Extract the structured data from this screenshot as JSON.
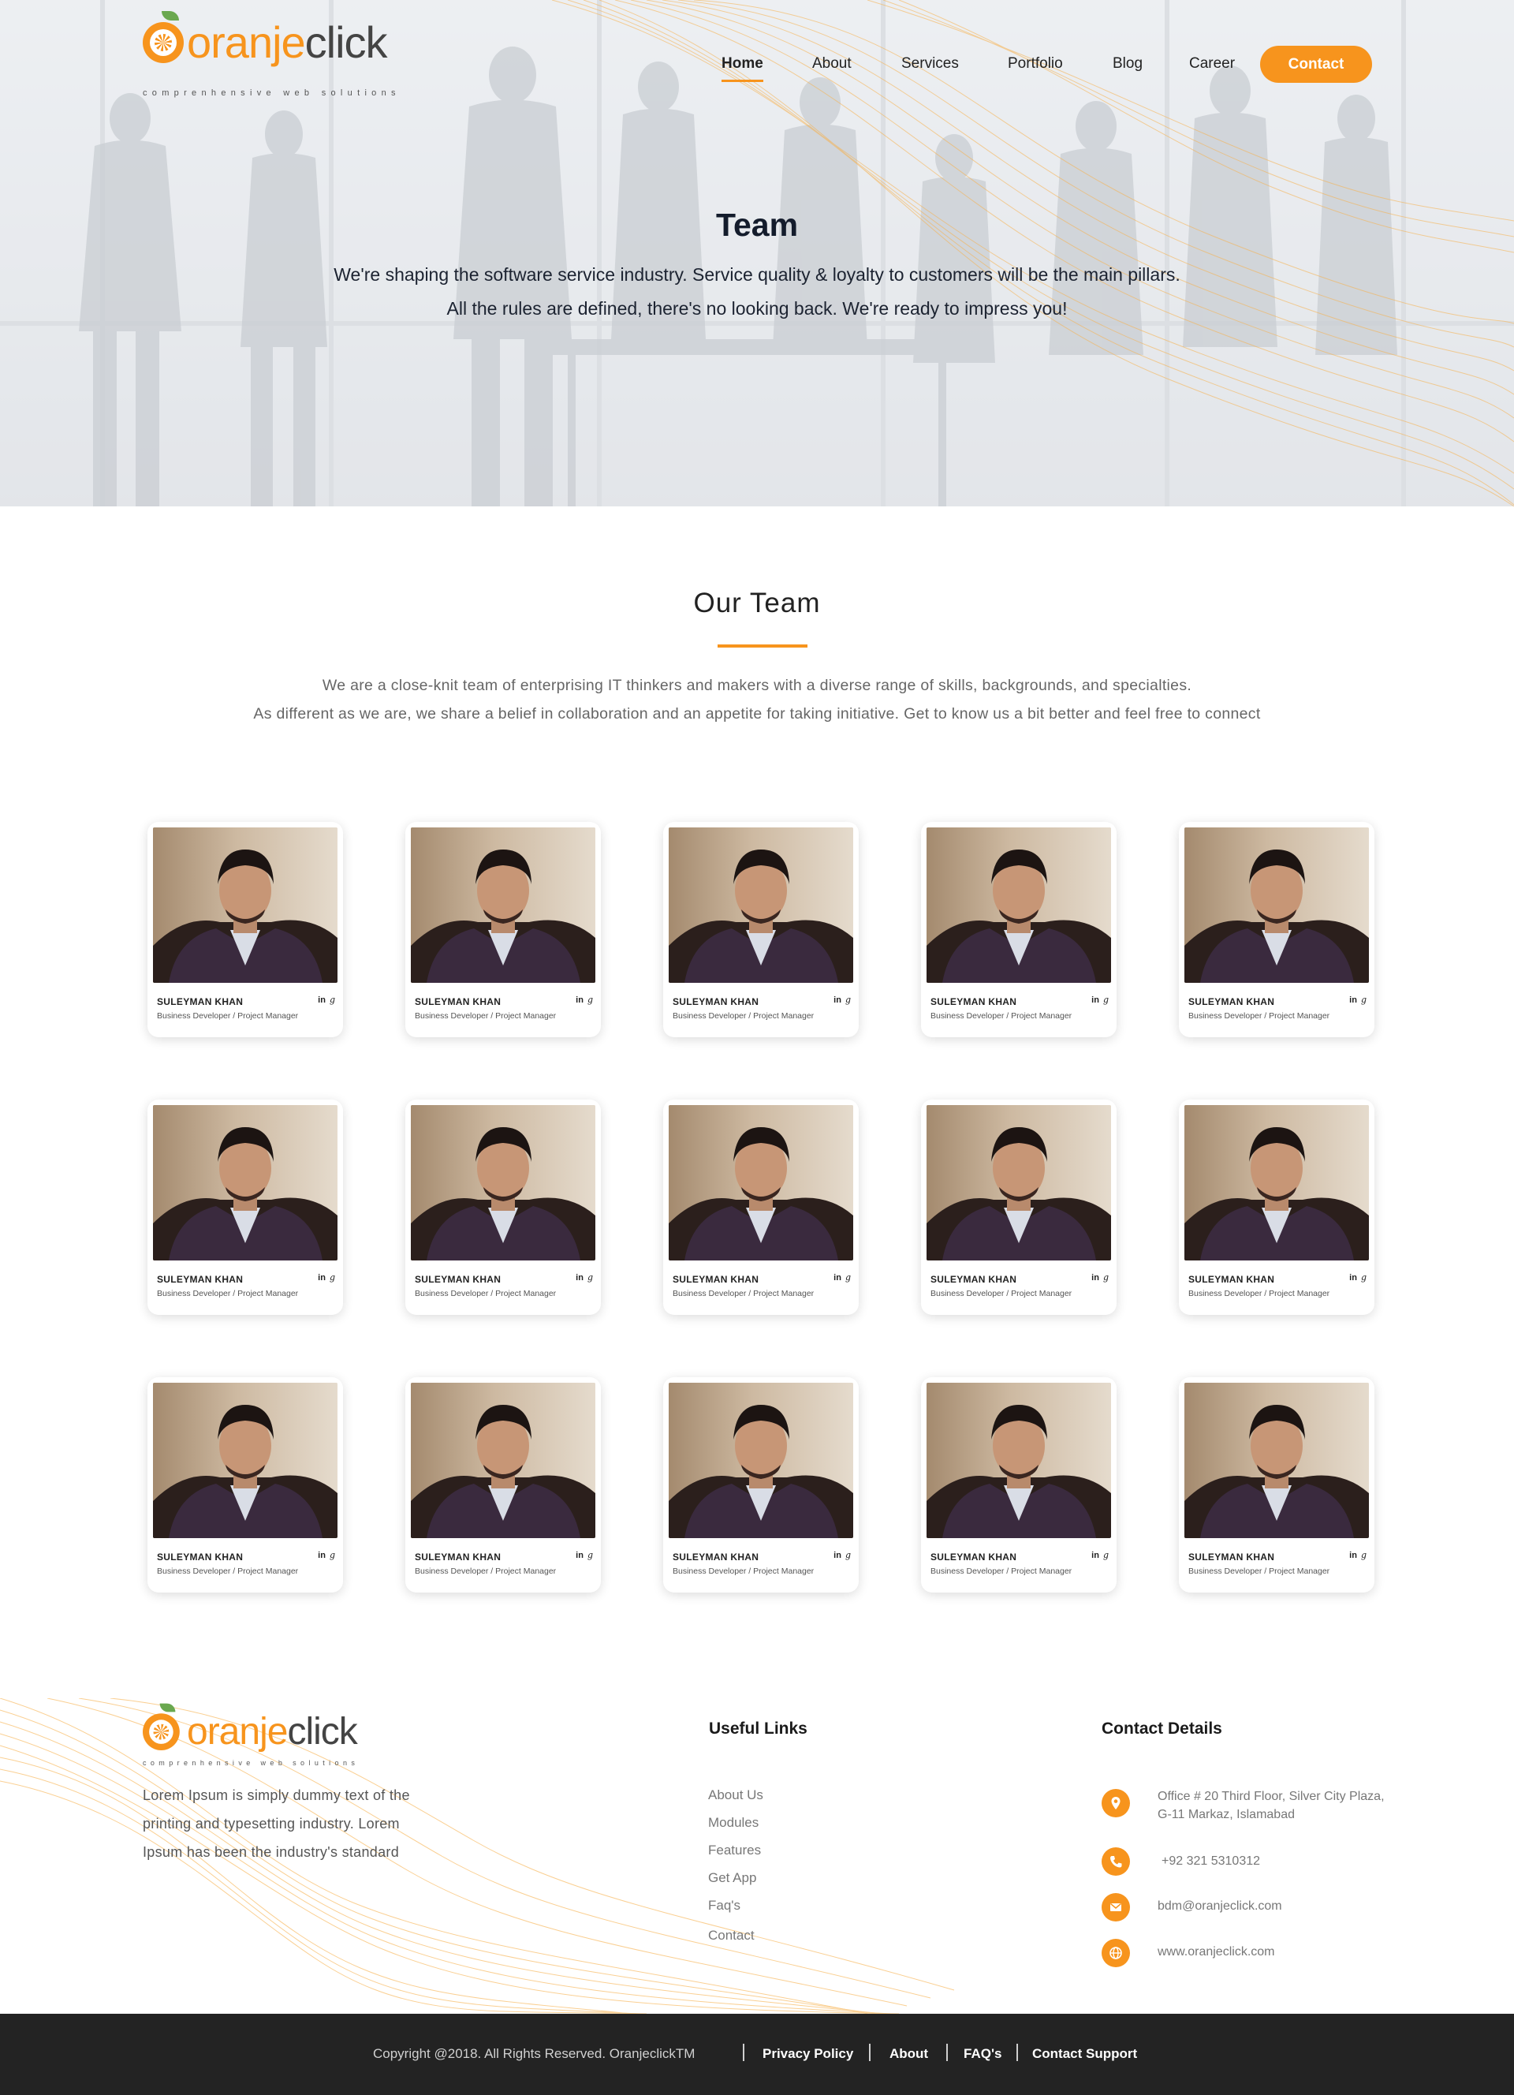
{
  "brand": {
    "name_orange": "oranje",
    "name_gray": "click",
    "tagline": "comprenhensive web solutions",
    "accent_color": "#f7941d"
  },
  "nav": {
    "items": [
      "Home",
      "About",
      "Services",
      "Portfolio",
      "Blog",
      "Career"
    ],
    "active": "Home",
    "contact_label": "Contact"
  },
  "hero": {
    "title": "Team",
    "line1": "We're shaping the software service industry. Service quality & loyalty to customers will be the main pillars.",
    "line2": "All the rules are defined, there's no looking back. We're ready to impress you!"
  },
  "team_section": {
    "title": "Our Team",
    "desc1": "We are a close-knit team of enterprising IT thinkers and makers with a diverse range of skills, backgrounds, and specialties.",
    "desc2": "As different as we are, we share a belief in collaboration and an appetite for taking initiative. Get to know us a bit better and feel free to connect"
  },
  "members": [
    {
      "name": "SULEYMAN KHAN",
      "role": "Business Developer / Project Manager"
    },
    {
      "name": "SULEYMAN KHAN",
      "role": "Business Developer / Project Manager"
    },
    {
      "name": "SULEYMAN KHAN",
      "role": "Business Developer / Project Manager"
    },
    {
      "name": "SULEYMAN KHAN",
      "role": "Business Developer / Project Manager"
    },
    {
      "name": "SULEYMAN KHAN",
      "role": "Business Developer / Project Manager"
    },
    {
      "name": "SULEYMAN KHAN",
      "role": "Business Developer / Project Manager"
    },
    {
      "name": "SULEYMAN KHAN",
      "role": "Business Developer / Project Manager"
    },
    {
      "name": "SULEYMAN KHAN",
      "role": "Business Developer / Project Manager"
    },
    {
      "name": "SULEYMAN KHAN",
      "role": "Business Developer / Project Manager"
    },
    {
      "name": "SULEYMAN KHAN",
      "role": "Business Developer / Project Manager"
    },
    {
      "name": "SULEYMAN KHAN",
      "role": "Business Developer / Project Manager"
    },
    {
      "name": "SULEYMAN KHAN",
      "role": "Business Developer / Project Manager"
    },
    {
      "name": "SULEYMAN KHAN",
      "role": "Business Developer / Project Manager"
    },
    {
      "name": "SULEYMAN KHAN",
      "role": "Business Developer / Project Manager"
    },
    {
      "name": "SULEYMAN KHAN",
      "role": "Business Developer / Project Manager"
    }
  ],
  "social": {
    "linkedin": "in",
    "google": "g"
  },
  "footer": {
    "about": "Lorem Ipsum is simply dummy text of the printing and typesetting industry. Lorem Ipsum has been the industry's standard",
    "links_title": "Useful Links",
    "links": [
      "About Us",
      "Modules",
      "Features",
      "Get App",
      "Faq's",
      "Contact"
    ],
    "contact_title": "Contact Details",
    "address_line1": "Office # 20 Third Floor, Silver City Plaza,",
    "address_line2": "G-11 Markaz, Islamabad",
    "phone": "+92 321 5310312",
    "email": "bdm@oranjeclick.com",
    "website": "www.oranjeclick.com",
    "icons": [
      "location-icon",
      "phone-icon",
      "mail-icon",
      "globe-icon"
    ]
  },
  "bottom_bar": {
    "copyright": "Copyright @2018. All Rights Reserved. OranjeclickTM",
    "links": [
      "Privacy Policy",
      "About",
      "FAQ's",
      "Contact Support"
    ]
  }
}
